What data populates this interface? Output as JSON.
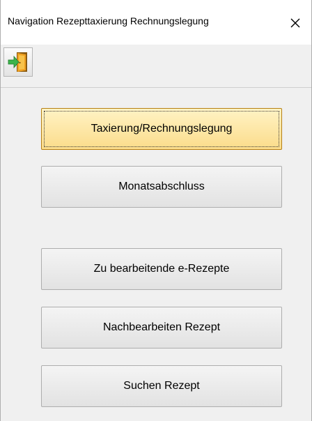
{
  "window": {
    "title": "Navigation Rezepttaxierung Rechnungslegung",
    "close_icon": "close-icon"
  },
  "toolbar": {
    "exit_icon": "exit-door-icon",
    "exit_icon_colors": {
      "arrow": "#3cb44b",
      "door": "#f0a020",
      "frame": "#8a5a10"
    }
  },
  "menu": {
    "buttons": [
      {
        "label": "Taxierung/Rechnungslegung",
        "active": true
      },
      {
        "label": "Monatsabschluss",
        "active": false
      },
      {
        "label": "Zu bearbeitende e-Rezepte",
        "active": false
      },
      {
        "label": "Nachbearbeiten Rezept",
        "active": false
      },
      {
        "label": "Suchen Rezept",
        "active": false
      }
    ]
  },
  "colors": {
    "active_button_top": "#fff3c5",
    "active_button_bottom": "#fbdc8a",
    "active_button_border": "#b57f14",
    "button_top": "#f4f4f4",
    "button_bottom": "#e2e2e2",
    "button_border": "#adadad",
    "background": "#f0f0f0"
  }
}
